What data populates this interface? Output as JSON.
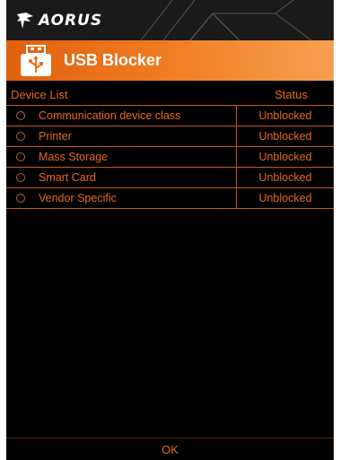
{
  "brand": {
    "logo_text": "AORUS",
    "logo_icon": "aorus-eagle-icon"
  },
  "title": {
    "text": "USB Blocker",
    "icon": "usb-drive-icon"
  },
  "table": {
    "header_left": "Device List",
    "header_right": "Status",
    "rows": [
      {
        "device": "Communication device class",
        "status": "Unblocked"
      },
      {
        "device": "Printer",
        "status": "Unblocked"
      },
      {
        "device": "Mass Storage",
        "status": "Unblocked"
      },
      {
        "device": "Smart Card",
        "status": "Unblocked"
      },
      {
        "device": "Vendor Specific",
        "status": "Unblocked"
      }
    ]
  },
  "footer": {
    "ok_label": "OK"
  },
  "colors": {
    "accent": "#e56a1f",
    "title_gradient_start": "#e06010",
    "title_gradient_end": "#f7a050",
    "background": "#000000"
  }
}
